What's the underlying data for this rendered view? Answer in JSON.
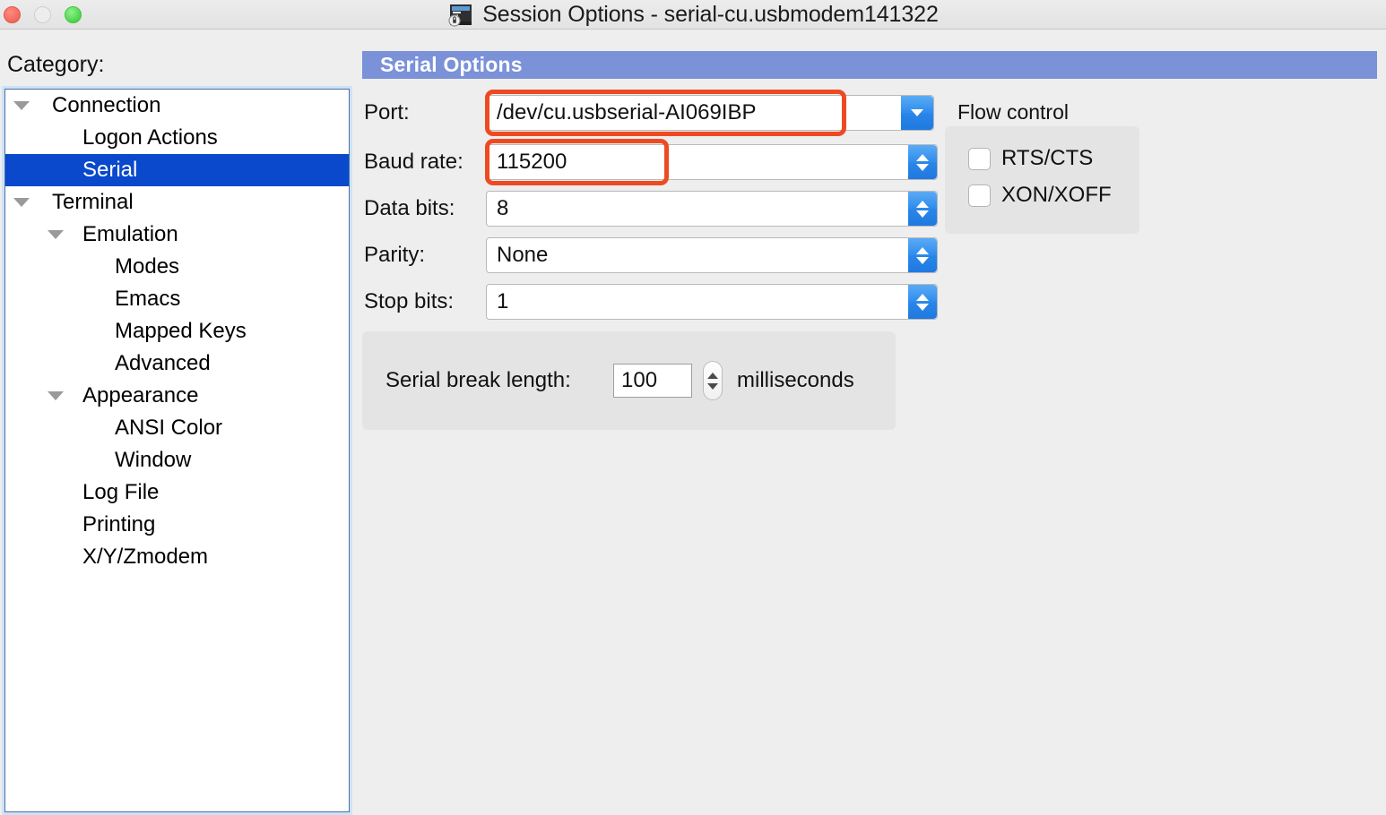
{
  "window": {
    "title": "Session Options - serial-cu.usbmodem141322",
    "icon": "terminal-lock-icon",
    "traffic_lights": {
      "close_label": "close",
      "minimize_label": "minimize",
      "zoom_label": "zoom",
      "close_color": "#f0675c",
      "minimize_color": "#ededed",
      "zoom_color": "#4cd24a"
    }
  },
  "sidebar": {
    "heading": "Category:",
    "items": [
      {
        "label": "Connection",
        "depth": 0,
        "twisty": true,
        "selected": false
      },
      {
        "label": "Logon Actions",
        "depth": 1,
        "twisty": false,
        "selected": false
      },
      {
        "label": "Serial",
        "depth": 1,
        "twisty": false,
        "selected": true
      },
      {
        "label": "Terminal",
        "depth": 0,
        "twisty": true,
        "selected": false
      },
      {
        "label": "Emulation",
        "depth": 1,
        "twisty": true,
        "selected": false
      },
      {
        "label": "Modes",
        "depth": 2,
        "twisty": false,
        "selected": false
      },
      {
        "label": "Emacs",
        "depth": 2,
        "twisty": false,
        "selected": false
      },
      {
        "label": "Mapped Keys",
        "depth": 2,
        "twisty": false,
        "selected": false
      },
      {
        "label": "Advanced",
        "depth": 2,
        "twisty": false,
        "selected": false
      },
      {
        "label": "Appearance",
        "depth": 1,
        "twisty": true,
        "selected": false
      },
      {
        "label": "ANSI Color",
        "depth": 2,
        "twisty": false,
        "selected": false
      },
      {
        "label": "Window",
        "depth": 2,
        "twisty": false,
        "selected": false
      },
      {
        "label": "Log File",
        "depth": 1,
        "twisty": false,
        "selected": false
      },
      {
        "label": "Printing",
        "depth": 1,
        "twisty": false,
        "selected": false
      },
      {
        "label": "X/Y/Zmodem",
        "depth": 1,
        "twisty": false,
        "selected": false
      }
    ],
    "selected_color": "#0a48cc"
  },
  "main": {
    "section_title": "Serial Options",
    "section_title_bg": "#7b91d8",
    "fields": {
      "port": {
        "label": "Port:",
        "value": "/dev/cu.usbserial-AI069IBP",
        "control": "combobox",
        "highlighted": true
      },
      "baud_rate": {
        "label": "Baud rate:",
        "value": "115200",
        "control": "stepper",
        "highlighted": true
      },
      "data_bits": {
        "label": "Data bits:",
        "value": "8",
        "control": "stepper",
        "highlighted": false
      },
      "parity": {
        "label": "Parity:",
        "value": "None",
        "control": "stepper",
        "highlighted": false
      },
      "stop_bits": {
        "label": "Stop bits:",
        "value": "1",
        "control": "stepper",
        "highlighted": false
      }
    },
    "flow_control": {
      "label": "Flow control",
      "options": [
        {
          "label": "RTS/CTS",
          "checked": false
        },
        {
          "label": "XON/XOFF",
          "checked": false
        }
      ]
    },
    "serial_break": {
      "label": "Serial break length:",
      "value": "100",
      "unit": "milliseconds"
    },
    "annotation_color": "#ee4a22"
  }
}
